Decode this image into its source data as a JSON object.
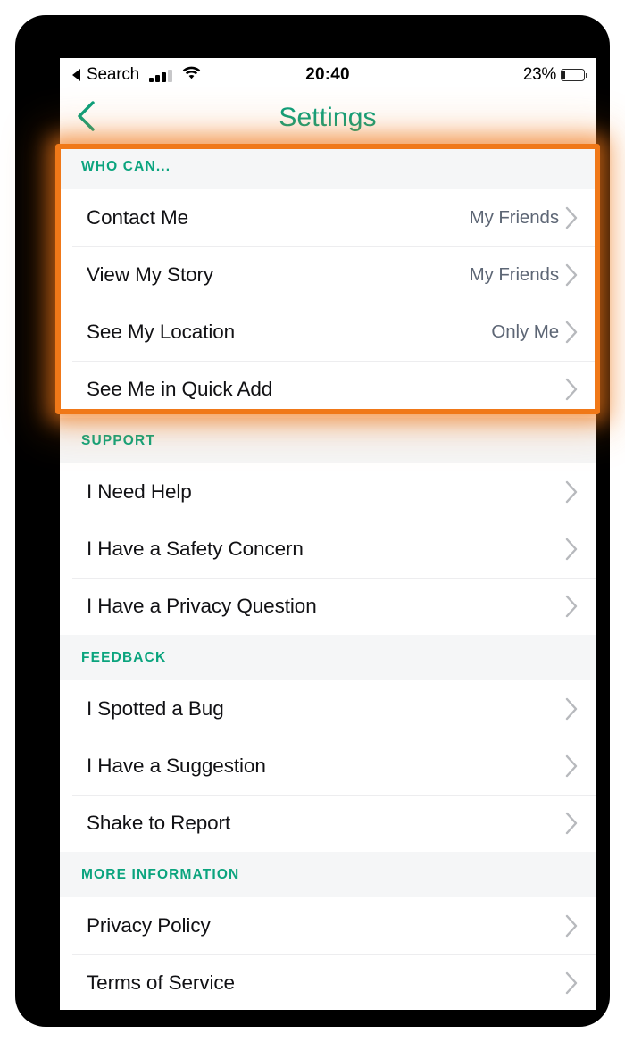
{
  "status_bar": {
    "back_arrow_icon": "triangle-left-icon",
    "carrier_label": "Search",
    "signal_icon": "cellular-signal-icon",
    "signal_bars_filled": 3,
    "signal_bars_total": 4,
    "wifi_icon": "wifi-icon",
    "time": "20:40",
    "battery_percent_label": "23%",
    "battery_icon": "battery-icon",
    "battery_level": 23
  },
  "nav_bar": {
    "back_icon": "chevron-left-icon",
    "title": "Settings",
    "title_color": "#0aa07c"
  },
  "highlight": {
    "color": "#f07818",
    "target_section": "WHO CAN..."
  },
  "sections": [
    {
      "header": "WHO CAN...",
      "rows": [
        {
          "label": "Contact Me",
          "value": "My Friends",
          "chevron_icon": "chevron-right-icon"
        },
        {
          "label": "View My Story",
          "value": "My Friends",
          "chevron_icon": "chevron-right-icon"
        },
        {
          "label": "See My Location",
          "value": "Only Me",
          "chevron_icon": "chevron-right-icon"
        },
        {
          "label": "See Me in Quick Add",
          "value": "",
          "chevron_icon": "chevron-right-icon"
        }
      ]
    },
    {
      "header": "SUPPORT",
      "rows": [
        {
          "label": "I Need Help",
          "value": "",
          "chevron_icon": "chevron-right-icon"
        },
        {
          "label": "I Have a Safety Concern",
          "value": "",
          "chevron_icon": "chevron-right-icon"
        },
        {
          "label": "I Have a Privacy Question",
          "value": "",
          "chevron_icon": "chevron-right-icon"
        }
      ]
    },
    {
      "header": "FEEDBACK",
      "rows": [
        {
          "label": "I Spotted a Bug",
          "value": "",
          "chevron_icon": "chevron-right-icon"
        },
        {
          "label": "I Have a Suggestion",
          "value": "",
          "chevron_icon": "chevron-right-icon"
        },
        {
          "label": "Shake to Report",
          "value": "",
          "chevron_icon": "chevron-right-icon"
        }
      ]
    },
    {
      "header": "MORE INFORMATION",
      "rows": [
        {
          "label": "Privacy Policy",
          "value": "",
          "chevron_icon": "chevron-right-icon"
        },
        {
          "label": "Terms of Service",
          "value": "",
          "chevron_icon": "chevron-right-icon"
        }
      ]
    }
  ]
}
